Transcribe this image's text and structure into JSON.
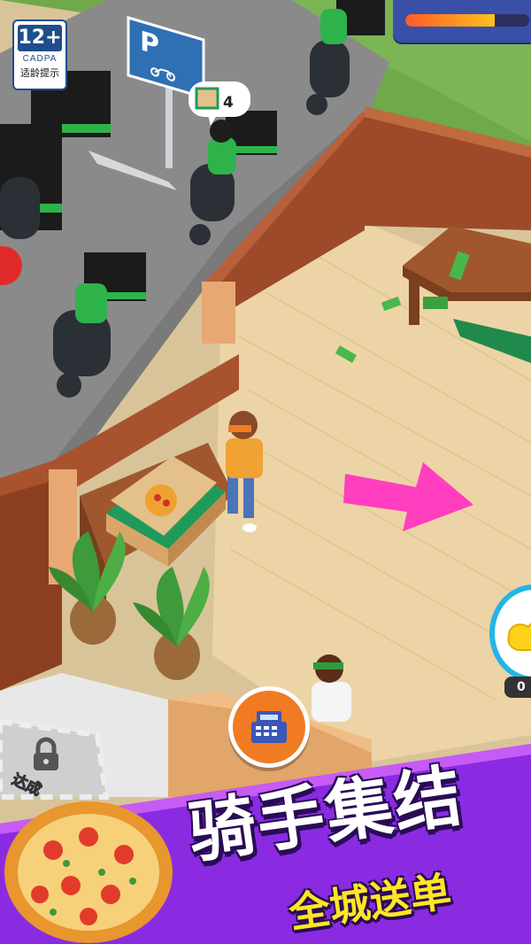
{
  "age_rating": {
    "age": "12+",
    "org": "CADPA",
    "tip": "适龄提示"
  },
  "top_hud": {
    "progress": 0.72,
    "accent": "#ffc21a"
  },
  "parking_sign": {
    "letter": "P",
    "icon": "motorcycle-icon"
  },
  "order_bubble": {
    "icon": "pizza-box-icon",
    "count": "4"
  },
  "cashier_button": {
    "icon": "cash-register-icon",
    "color": "#f07b23"
  },
  "side_button": {
    "icon": "glove-icon",
    "count": "0"
  },
  "locked_area": {
    "icon": "lock-icon",
    "label": "达成"
  },
  "promo": {
    "title": "骑手集结",
    "subtitle": "全城送单",
    "banner_color": "#8a2be2"
  },
  "colors": {
    "grass": "#6fa94a",
    "road": "#8a8a8a",
    "floor": "#ecd4a6",
    "wall": "#9c4a2a",
    "arrow": "#ff3fbf"
  }
}
